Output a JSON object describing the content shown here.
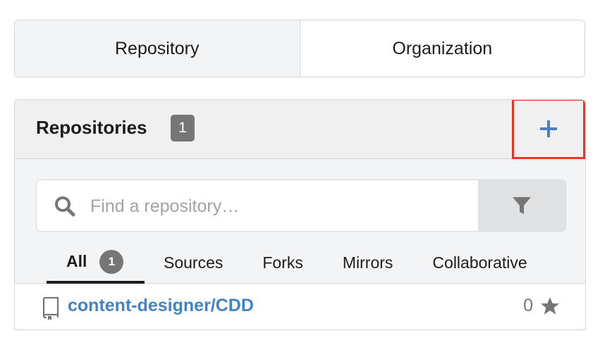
{
  "switcher": {
    "tabs": [
      {
        "label": "Repository",
        "active": true
      },
      {
        "label": "Organization",
        "active": false
      }
    ]
  },
  "panel": {
    "title": "Repositories",
    "count": "1",
    "add_icon": "plus-icon",
    "highlight_color": "#ee3322"
  },
  "search": {
    "placeholder": "Find a repository…",
    "value": "",
    "search_icon": "search-icon",
    "filter_icon": "filter-icon"
  },
  "filters": {
    "all_label": "All",
    "all_count": "1",
    "sources_label": "Sources",
    "forks_label": "Forks",
    "mirrors_label": "Mirrors",
    "collaborative_label": "Collaborative"
  },
  "repos": [
    {
      "name": "content-designer/CDD",
      "stars": "0",
      "icon": "book-icon",
      "star_icon": "star-icon"
    }
  ],
  "colors": {
    "link": "#4183c4",
    "badge": "#767676",
    "add_icon": "#4a7fc0"
  }
}
